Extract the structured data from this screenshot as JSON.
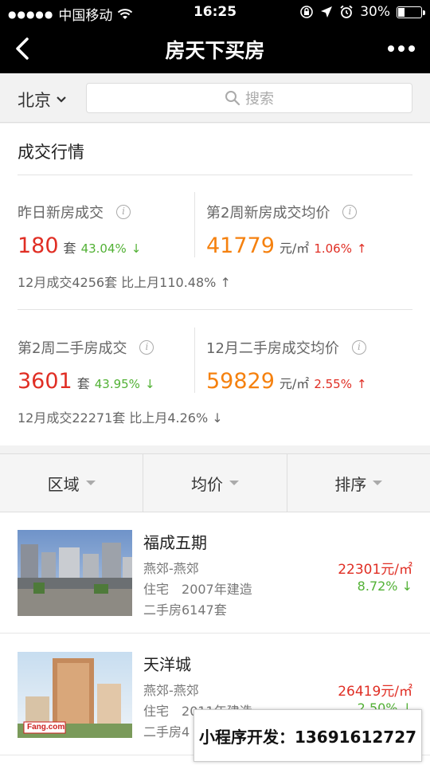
{
  "status_bar": {
    "carrier": "中国移动",
    "time": "16:25",
    "battery": "30%",
    "battery_level": 0.3
  },
  "nav": {
    "title": "房天下买房"
  },
  "search": {
    "city": "北京",
    "placeholder": "搜索"
  },
  "market": {
    "title": "成交行情",
    "block1": {
      "left": {
        "label": "昨日新房成交",
        "value": "180",
        "unit": "套",
        "change": "43.04%",
        "arrow": "↓"
      },
      "right": {
        "label": "第2周新房成交均价",
        "value": "41779",
        "unit": "元/㎡",
        "change": "1.06%",
        "arrow": "↑"
      },
      "summary": "12月成交4256套 比上月110.48% ↑"
    },
    "block2": {
      "left": {
        "label": "第2周二手房成交",
        "value": "3601",
        "unit": "套",
        "change": "43.95%",
        "arrow": "↓"
      },
      "right": {
        "label": "12月二手房成交均价",
        "value": "59829",
        "unit": "元/㎡",
        "change": "2.55%",
        "arrow": "↑"
      },
      "summary": "12月成交22271套 比上月4.26% ↓"
    }
  },
  "filters": [
    {
      "label": "区域"
    },
    {
      "label": "均价"
    },
    {
      "label": "排序"
    }
  ],
  "listings": [
    {
      "name": "福成五期",
      "area": "燕郊-燕郊",
      "type": "住宅",
      "year": "2007年建造",
      "stock": "二手房6147套",
      "price": "22301元/㎡",
      "change": "8.72% ↓"
    },
    {
      "name": "天洋城",
      "area": "燕郊-燕郊",
      "type": "住宅",
      "year": "2011年建造",
      "stock": "二手房4",
      "price": "26419元/㎡",
      "change": "2.50% ↓",
      "watermark": "Fang.com"
    }
  ],
  "overlay": {
    "text": "小程序开发：13691612727"
  }
}
